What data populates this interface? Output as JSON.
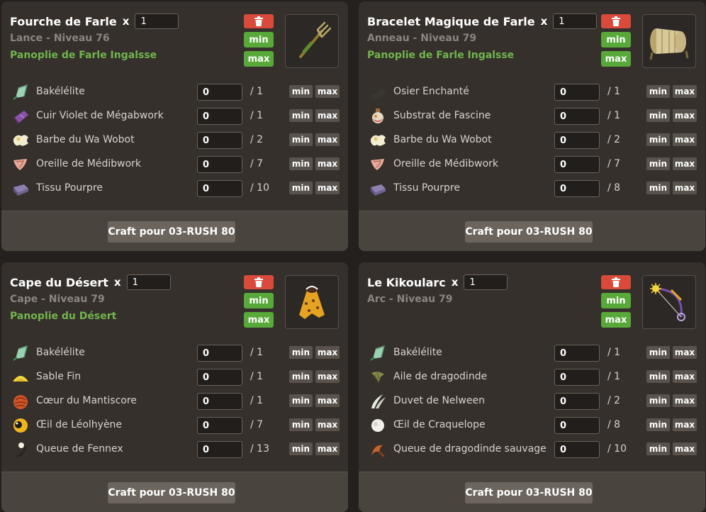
{
  "common": {
    "x_label": "x",
    "min_label": "min",
    "max_label": "max",
    "craft_label": "Craft pour 03-RUSH 80"
  },
  "cards": [
    {
      "name": "Fourche de Farle",
      "quantity": "1",
      "subtitle": "Lance - Niveau 76",
      "panoplie": "Panoplie de Farle Ingalsse",
      "item_icon": "pitchfork-icon",
      "ingredients": [
        {
          "name": "Bakélélite",
          "value": "0",
          "required": "/ 1",
          "icon": "bakelelite-icon"
        },
        {
          "name": "Cuir Violet de Mégabwork",
          "value": "0",
          "required": "/ 1",
          "icon": "leather-icon"
        },
        {
          "name": "Barbe du Wa Wobot",
          "value": "0",
          "required": "/ 2",
          "icon": "beard-icon"
        },
        {
          "name": "Oreille de Médibwork",
          "value": "0",
          "required": "/ 7",
          "icon": "ear-icon"
        },
        {
          "name": "Tissu Pourpre",
          "value": "0",
          "required": "/ 10",
          "icon": "fabric-icon"
        }
      ]
    },
    {
      "name": "Bracelet Magique de Farle",
      "quantity": "1",
      "subtitle": "Anneau - Niveau 79",
      "panoplie": "Panoplie de Farle Ingalsse",
      "item_icon": "bracelet-icon",
      "ingredients": [
        {
          "name": "Osier Enchanté",
          "value": "0",
          "required": "/ 1",
          "icon": "wicker-icon"
        },
        {
          "name": "Substrat de Fascine",
          "value": "0",
          "required": "/ 1",
          "icon": "potion-icon"
        },
        {
          "name": "Barbe du Wa Wobot",
          "value": "0",
          "required": "/ 2",
          "icon": "beard-icon"
        },
        {
          "name": "Oreille de Médibwork",
          "value": "0",
          "required": "/ 7",
          "icon": "ear-icon"
        },
        {
          "name": "Tissu Pourpre",
          "value": "0",
          "required": "/ 8",
          "icon": "fabric-icon"
        }
      ]
    },
    {
      "name": "Cape du Désert",
      "quantity": "1",
      "subtitle": "Cape - Niveau 79",
      "panoplie": "Panoplie du Désert",
      "item_icon": "cape-icon",
      "ingredients": [
        {
          "name": "Bakélélite",
          "value": "0",
          "required": "/ 1",
          "icon": "bakelelite-icon"
        },
        {
          "name": "Sable Fin",
          "value": "0",
          "required": "/ 1",
          "icon": "sand-icon"
        },
        {
          "name": "Cœur du Mantiscore",
          "value": "0",
          "required": "/ 1",
          "icon": "heart-icon"
        },
        {
          "name": "Œil de Léolhyène",
          "value": "0",
          "required": "/ 7",
          "icon": "eye-icon"
        },
        {
          "name": "Queue de Fennex",
          "value": "0",
          "required": "/ 13",
          "icon": "tail-icon"
        }
      ]
    },
    {
      "name": "Le Kikoularc",
      "quantity": "1",
      "subtitle": "Arc - Niveau 79",
      "panoplie": "",
      "item_icon": "bow-icon",
      "ingredients": [
        {
          "name": "Bakélélite",
          "value": "0",
          "required": "/ 1",
          "icon": "bakelelite-icon"
        },
        {
          "name": "Aile de dragodinde",
          "value": "0",
          "required": "/ 1",
          "icon": "wing-icon"
        },
        {
          "name": "Duvet de Nelween",
          "value": "0",
          "required": "/ 2",
          "icon": "feather-icon"
        },
        {
          "name": "Œil de Craquelope",
          "value": "0",
          "required": "/ 8",
          "icon": "white-eye-icon"
        },
        {
          "name": "Queue de dragodinde sauvage",
          "value": "0",
          "required": "/ 10",
          "icon": "dragon-tail-icon"
        }
      ]
    }
  ]
}
